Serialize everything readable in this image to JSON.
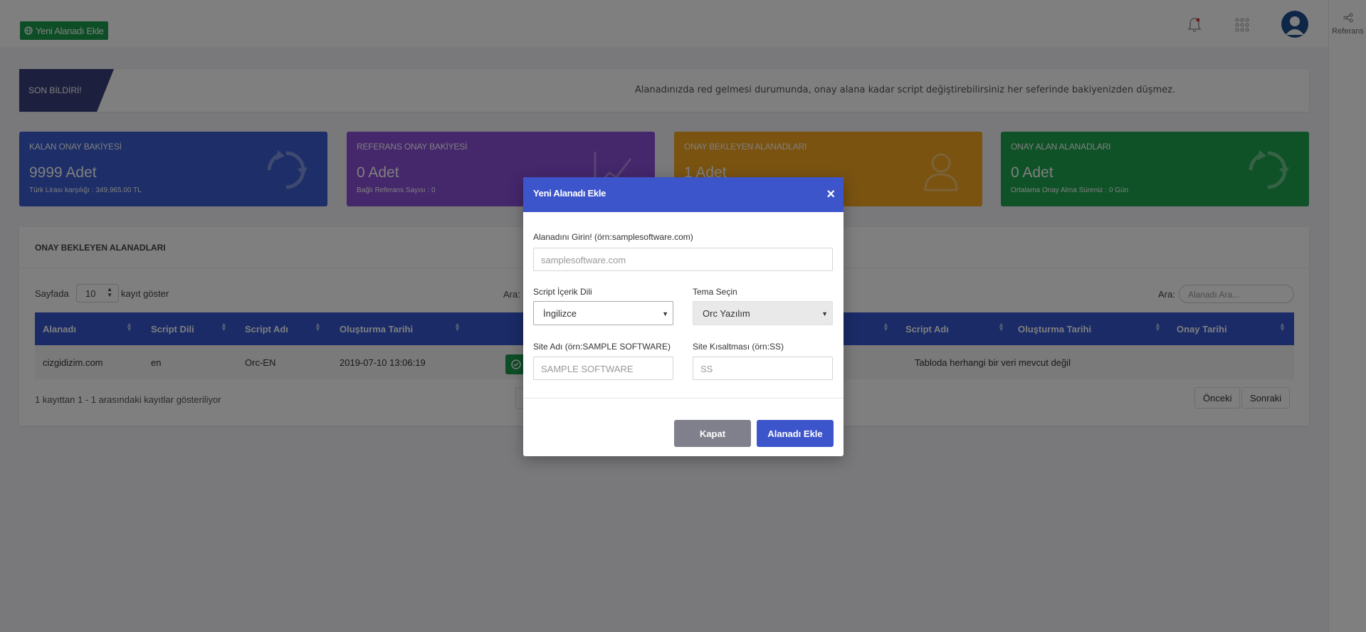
{
  "topbar": {
    "add_domain_label": "Yeni Alanadı Ekle",
    "right_rail_label": "Referans"
  },
  "notice": {
    "tag": "SON BİLDİRİ!",
    "text": "Alanadınızda red gelmesi durumunda, onay alana kadar script değiştirebilirsiniz her seferinde bakiyenizden düşmez."
  },
  "cards": [
    {
      "title": "KALAN ONAY BAKİYESİ",
      "value": "9999 Adet",
      "sub": "Türk Lirası karşılığı : 349,965.00 TL",
      "color": "#3b5cd0",
      "icon": "refresh-icon"
    },
    {
      "title": "REFERANS ONAY BAKİYESİ",
      "value": "0 Adet",
      "sub": "Bağlı Referans Sayısı : 0",
      "color": "#8a4fd8",
      "icon": "chart-icon"
    },
    {
      "title": "ONAY BEKLEYEN ALANADLARI",
      "value": "1 Adet",
      "sub": "",
      "color": "#f5a623",
      "icon": "user-icon"
    },
    {
      "title": "ONAY ALAN ALANADLARI",
      "value": "0 Adet",
      "sub": "Ortalama Onay Alma Süreniz : 0 Gün",
      "color": "#1ea54f",
      "icon": "refresh-icon"
    }
  ],
  "panel": {
    "title": "ONAY BEKLEYEN ALANADLARI",
    "length_prefix": "Sayfada",
    "length_value": "10",
    "length_suffix": "kayıt göster",
    "search_label_left": "Ara:",
    "search_label_right": "Ara:",
    "search_placeholder": "Alanadı Ara...",
    "left_columns": [
      "Alanadı",
      "Script Dili",
      "Script Adı",
      "Oluşturma Tarihi"
    ],
    "right_columns": [
      "Script Adı",
      "Oluşturma Tarihi",
      "Onay Tarihi"
    ],
    "row": {
      "domain": "cizgidizim.com",
      "lang": "en",
      "script": "Orc-EN",
      "date": "2019-07-10 13:06:19"
    },
    "empty_text": "Tabloda herhangi bir veri mevcut değil",
    "info": "1 kayıttan 1 - 1 arasındaki kayıtlar gösteriliyor",
    "prev": "Önceki",
    "next": "Sonraki"
  },
  "modal": {
    "title": "Yeni Alanadı Ekle",
    "close": "×",
    "domain_label": "Alanadını Girin! (örn:samplesoftware.com)",
    "domain_placeholder": "samplesoftware.com",
    "lang_label": "Script İçerik Dili",
    "lang_value": "İngilizce",
    "theme_label": "Tema Seçin",
    "theme_value": "Orc Yazılım",
    "site_name_label": "Site Adı (örn:SAMPLE SOFTWARE)",
    "site_name_placeholder": "SAMPLE SOFTWARE",
    "site_abbr_label": "Site Kısaltması (örn:SS)",
    "site_abbr_placeholder": "SS",
    "close_btn": "Kapat",
    "submit_btn": "Alanadı Ekle"
  },
  "colors": {
    "primary": "#3d55cb",
    "success": "#1d9d4f",
    "table_head": "#3557cf"
  }
}
